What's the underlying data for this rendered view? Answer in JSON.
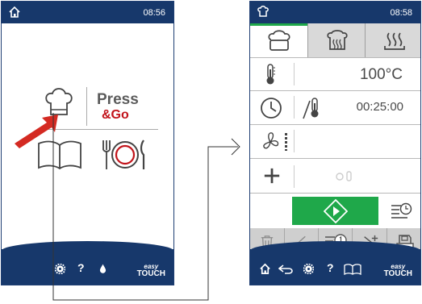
{
  "left_screen": {
    "time": "08:56",
    "home_icon": "home-icon",
    "press_label": "Press",
    "go_label": "&Go",
    "tiles": [
      "chef-hat-icon",
      "cookbook-icon",
      "plate-cutlery-icon"
    ],
    "bottom": {
      "help_label": "?",
      "easy_label": "easy",
      "touch_label": "TOUCH"
    }
  },
  "right_screen": {
    "time": "08:58",
    "tabs": [
      "steam-cook-icon",
      "combi-cook-icon",
      "hot-air-icon"
    ],
    "temperature": "100°C",
    "duration": "00:25:00",
    "bottom": {
      "help_label": "?",
      "easy_label": "easy",
      "touch_label": "TOUCH"
    },
    "colors": {
      "start": "#1fa84a",
      "accent": "#17386b"
    }
  }
}
